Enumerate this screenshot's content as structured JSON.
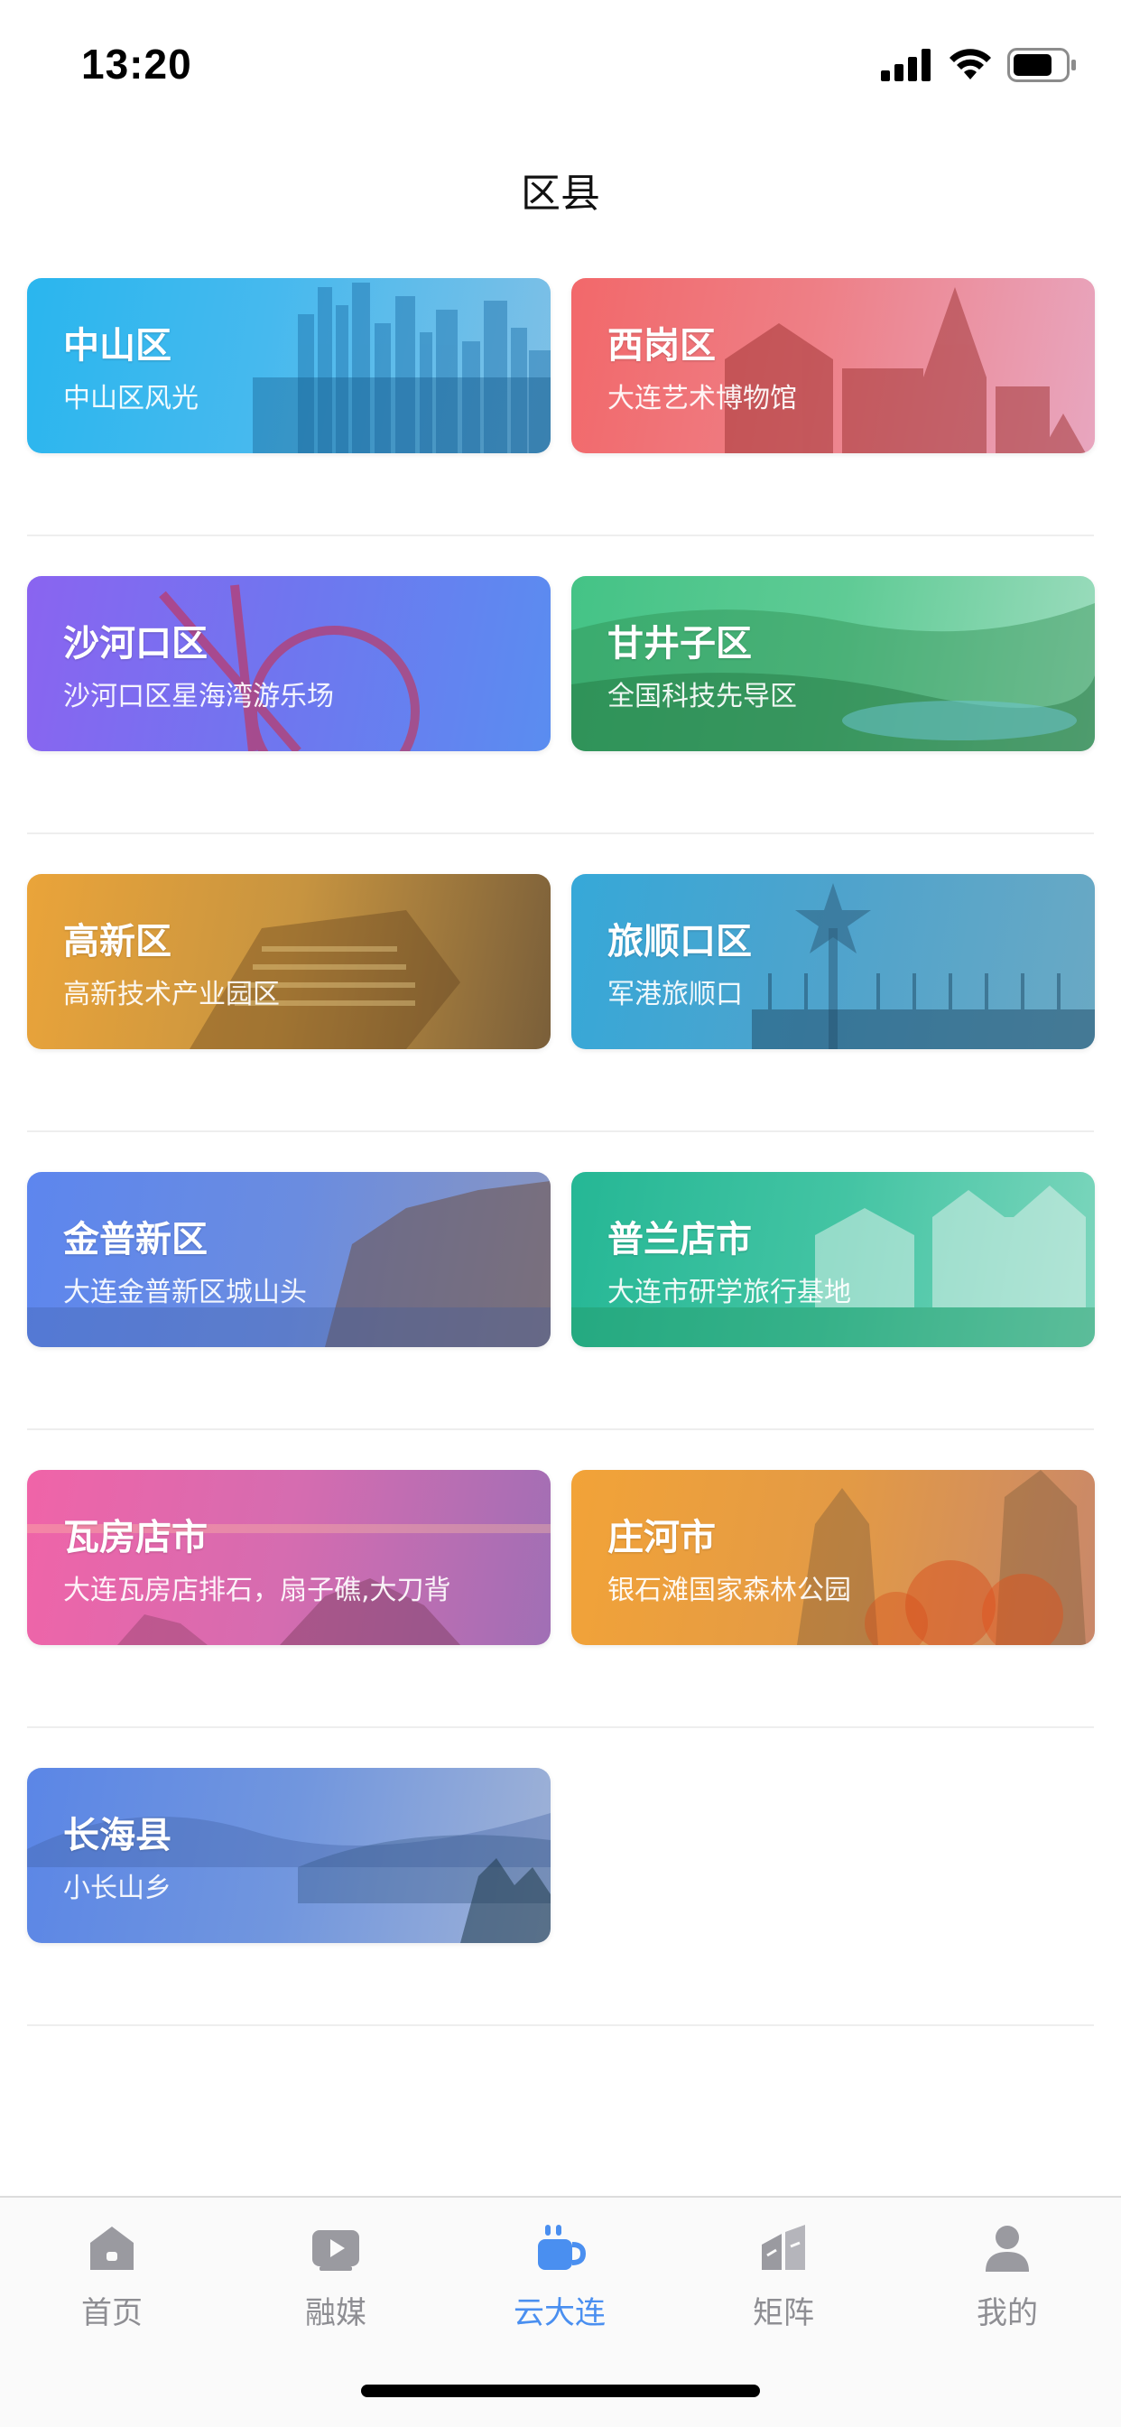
{
  "status_bar": {
    "time": "13:20"
  },
  "header": {
    "title": "区县"
  },
  "districts": [
    {
      "name": "中山区",
      "subtitle": "中山区风光",
      "gradient": [
        "#2bb7ef",
        "#6fc4f2"
      ]
    },
    {
      "name": "西岗区",
      "subtitle": "大连艺术博物馆",
      "gradient": [
        "#f36e6e",
        "#e9a0b8"
      ]
    },
    {
      "name": "沙河口区",
      "subtitle": "沙河口区星海湾游乐场",
      "gradient": [
        "#8b63f0",
        "#5f8bf2"
      ]
    },
    {
      "name": "甘井子区",
      "subtitle": "全国科技先导区",
      "gradient": [
        "#46c48a",
        "#8fd9b5"
      ]
    },
    {
      "name": "高新区",
      "subtitle": "高新技术产业园区",
      "gradient": [
        "#e9a33a",
        "#9a7a46"
      ]
    },
    {
      "name": "旅顺口区",
      "subtitle": "军港旅顺口",
      "gradient": [
        "#3aa9d6",
        "#5b9fc0"
      ]
    },
    {
      "name": "金普新区",
      "subtitle": "大连金普新区城山头",
      "gradient": [
        "#5f86ec",
        "#7a8fd0"
      ]
    },
    {
      "name": "普兰店市",
      "subtitle": "大连市研学旅行基地",
      "gradient": [
        "#2ab89a",
        "#5fd3b0"
      ]
    },
    {
      "name": "瓦房店市",
      "subtitle": "大连瓦房店排石，扇子礁,大刀背",
      "gradient": [
        "#ee63a8",
        "#b96fb3"
      ]
    },
    {
      "name": "庄河市",
      "subtitle": "银石滩国家森林公园",
      "gradient": [
        "#f2a33a",
        "#d98a4a"
      ]
    },
    {
      "name": "长海县",
      "subtitle": "小长山乡",
      "gradient": [
        "#5b86e6",
        "#8aa6d8"
      ]
    }
  ],
  "tab_bar": {
    "active_color": "#4a8ff0",
    "inactive_color": "#8e8e93",
    "tabs": [
      {
        "label": "首页",
        "icon": "home-icon"
      },
      {
        "label": "融媒",
        "icon": "video-play-icon"
      },
      {
        "label": "云大连",
        "icon": "coffee-cup-icon",
        "active": true
      },
      {
        "label": "矩阵",
        "icon": "buildings-icon"
      },
      {
        "label": "我的",
        "icon": "user-icon"
      }
    ]
  }
}
